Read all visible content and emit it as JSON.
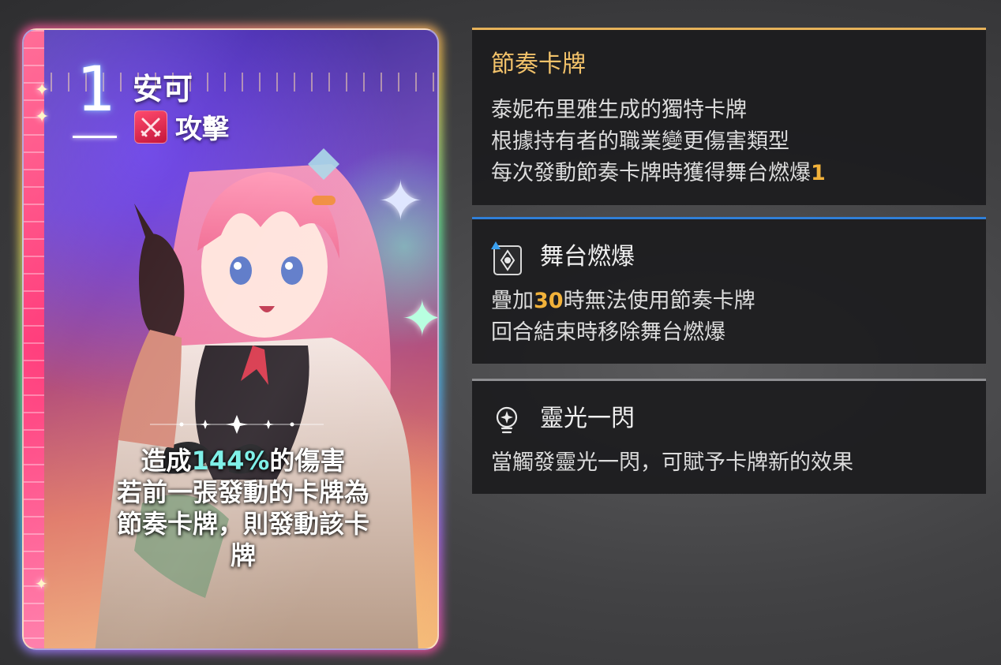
{
  "card": {
    "cost": "1",
    "name": "安可",
    "type_label": "攻擊",
    "type_icon": "crossed-swords-icon",
    "description": {
      "line1_prefix": "造成",
      "line1_highlight": "144%",
      "line1_suffix": "的傷害",
      "line2": "若前一張發動的卡牌為",
      "line3": "節奏卡牌，則發動該卡",
      "line4": "牌"
    },
    "colors": {
      "highlight": "#7ff0e8",
      "type_badge": "#e0284f"
    }
  },
  "panels": [
    {
      "title": "節奏卡牌",
      "lines": [
        "泰妮布里雅生成的獨特卡牌",
        "根據持有者的職業變更傷害類型"
      ],
      "line3_prefix": "每次發動節奏卡牌時獲得舞台燃爆",
      "line3_highlight": "1",
      "accent": "#e6b25a"
    },
    {
      "title": "舞台燃爆",
      "icon": "stage-card-icon",
      "line1_prefix": "疊加",
      "line1_highlight": "30",
      "line1_suffix": "時無法使用節奏卡牌",
      "line2": "回合結束時移除舞台燃爆",
      "accent": "#2f7fd8"
    },
    {
      "title": "靈光一閃",
      "icon": "lightbulb-icon",
      "line1": "當觸發靈光一閃，可賦予卡牌新的效果",
      "accent": "#8f8f92"
    }
  ]
}
